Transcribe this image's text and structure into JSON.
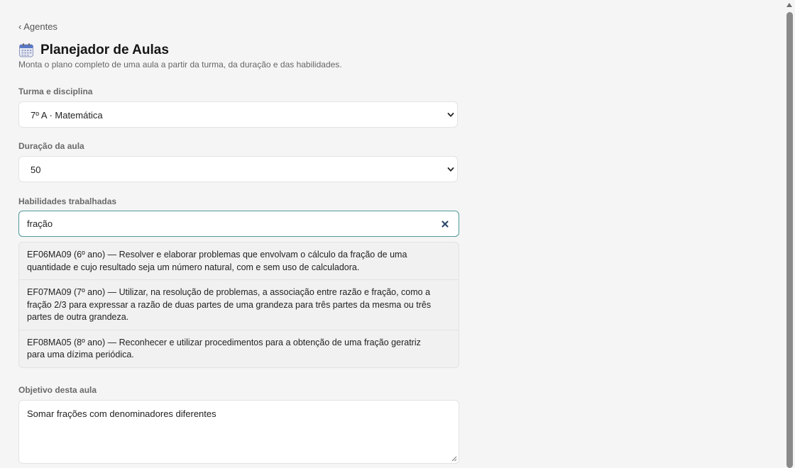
{
  "nav": {
    "back_label": "‹ Agentes"
  },
  "header": {
    "icon": "calendar-icon",
    "title": "Planejador de Aulas",
    "subtitle": "Monta o plano completo de uma aula a partir da turma, da duração e das habilidades."
  },
  "form": {
    "turma": {
      "label": "Turma e disciplina",
      "value": "7º A · Matemática"
    },
    "duracao": {
      "label": "Duração da aula",
      "value": "50"
    },
    "habilidades": {
      "label": "Habilidades trabalhadas",
      "search_value": "fração",
      "clear_icon": "close-icon",
      "results": [
        {
          "text": "EF06MA09 (6º ano) — Resolver e elaborar problemas que envolvam o cálculo da fração de uma quantidade e cujo resultado seja um número natural, com e sem uso de calculadora."
        },
        {
          "text": "EF07MA09 (7º ano) — Utilizar, na resolução de problemas, a associação entre razão e fração, como a fração 2/3 para expressar a razão de duas partes de uma grandeza para três partes da mesma ou três partes de outra grandeza."
        },
        {
          "text": "EF08MA05 (8º ano) — Reconhecer e utilizar procedimentos para a obtenção de uma fração geratriz para uma dízima periódica."
        }
      ]
    },
    "objetivo": {
      "label": "Objetivo desta aula",
      "value": "Somar frações com denominadores diferentes"
    }
  },
  "colors": {
    "background": "#f5f5f5",
    "focus_border": "#4f9a98",
    "clear_icon": "#2f4a6b"
  }
}
